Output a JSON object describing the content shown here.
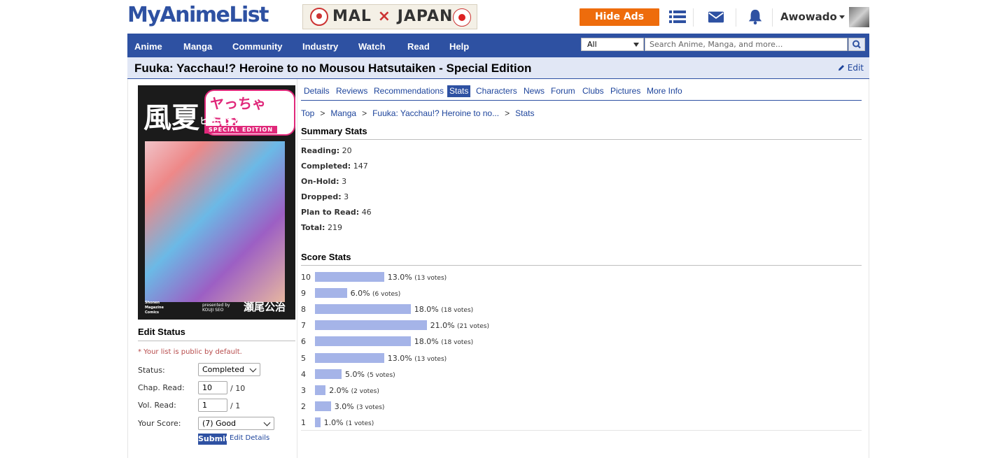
{
  "header": {
    "logo": "MyAnimeList",
    "banner": {
      "left": "MAL",
      "x": "×",
      "right": "JAPAN"
    },
    "hide_ads": "Hide Ads",
    "username": "Awowado"
  },
  "nav": {
    "items": [
      "Anime",
      "Manga",
      "Community",
      "Industry",
      "Watch",
      "Read",
      "Help"
    ],
    "search_scope": "All",
    "search_placeholder": "Search Anime, Manga, and more..."
  },
  "title": "Fuuka: Yacchau!? Heroine to no Mousou Hatsutaiken - Special Edition",
  "edit_label": "Edit",
  "cover": {
    "title_kanji": "風夏",
    "title_kana": "ヤっちゃう!?",
    "subtitle": "ヒロインとの妄想初体験",
    "edition": "SPECIAL EDITION",
    "author": "瀬尾公治",
    "presented": "presented by KOUJI SEO",
    "publisher": "Shonen Magazine Comics"
  },
  "tabs": [
    "Details",
    "Reviews",
    "Recommendations",
    "Stats",
    "Characters",
    "News",
    "Forum",
    "Clubs",
    "Pictures",
    "More Info"
  ],
  "active_tab": "Stats",
  "breadcrumb": [
    "Top",
    "Manga",
    "Fuuka: Yacchau!? Heroine to no...",
    "Stats"
  ],
  "summary": {
    "title": "Summary Stats",
    "rows": [
      {
        "label": "Reading:",
        "value": "20"
      },
      {
        "label": "Completed:",
        "value": "147"
      },
      {
        "label": "On-Hold:",
        "value": "3"
      },
      {
        "label": "Dropped:",
        "value": "3"
      },
      {
        "label": "Plan to Read:",
        "value": "46"
      },
      {
        "label": "Total:",
        "value": "219"
      }
    ]
  },
  "score_stats": {
    "title": "Score Stats",
    "rows": [
      {
        "score": "10",
        "pct": 13.0,
        "pct_label": "13.0%",
        "votes": "(13 votes)"
      },
      {
        "score": "9",
        "pct": 6.0,
        "pct_label": "6.0%",
        "votes": "(6 votes)"
      },
      {
        "score": "8",
        "pct": 18.0,
        "pct_label": "18.0%",
        "votes": "(18 votes)"
      },
      {
        "score": "7",
        "pct": 21.0,
        "pct_label": "21.0%",
        "votes": "(21 votes)"
      },
      {
        "score": "6",
        "pct": 18.0,
        "pct_label": "18.0%",
        "votes": "(18 votes)"
      },
      {
        "score": "5",
        "pct": 13.0,
        "pct_label": "13.0%",
        "votes": "(13 votes)"
      },
      {
        "score": "4",
        "pct": 5.0,
        "pct_label": "5.0%",
        "votes": "(5 votes)"
      },
      {
        "score": "3",
        "pct": 2.0,
        "pct_label": "2.0%",
        "votes": "(2 votes)"
      },
      {
        "score": "2",
        "pct": 3.0,
        "pct_label": "3.0%",
        "votes": "(3 votes)"
      },
      {
        "score": "1",
        "pct": 1.0,
        "pct_label": "1.0%",
        "votes": "(1 votes)"
      }
    ]
  },
  "edit_status": {
    "title": "Edit Status",
    "note": "* Your list is public by default.",
    "status_label": "Status:",
    "status_value": "Completed",
    "chap_label": "Chap. Read:",
    "chap_value": "10",
    "chap_total": "/ 10",
    "vol_label": "Vol. Read:",
    "vol_value": "1",
    "vol_total": "/ 1",
    "score_label": "Your Score:",
    "score_value": "(7) Good",
    "submit": "Submit",
    "edit_details": "Edit Details"
  },
  "colors": {
    "brand": "#2e51a2",
    "accent": "#ee6c0c",
    "bar": "#a5b4e8",
    "titlebar_bg": "#e1e7f5"
  }
}
